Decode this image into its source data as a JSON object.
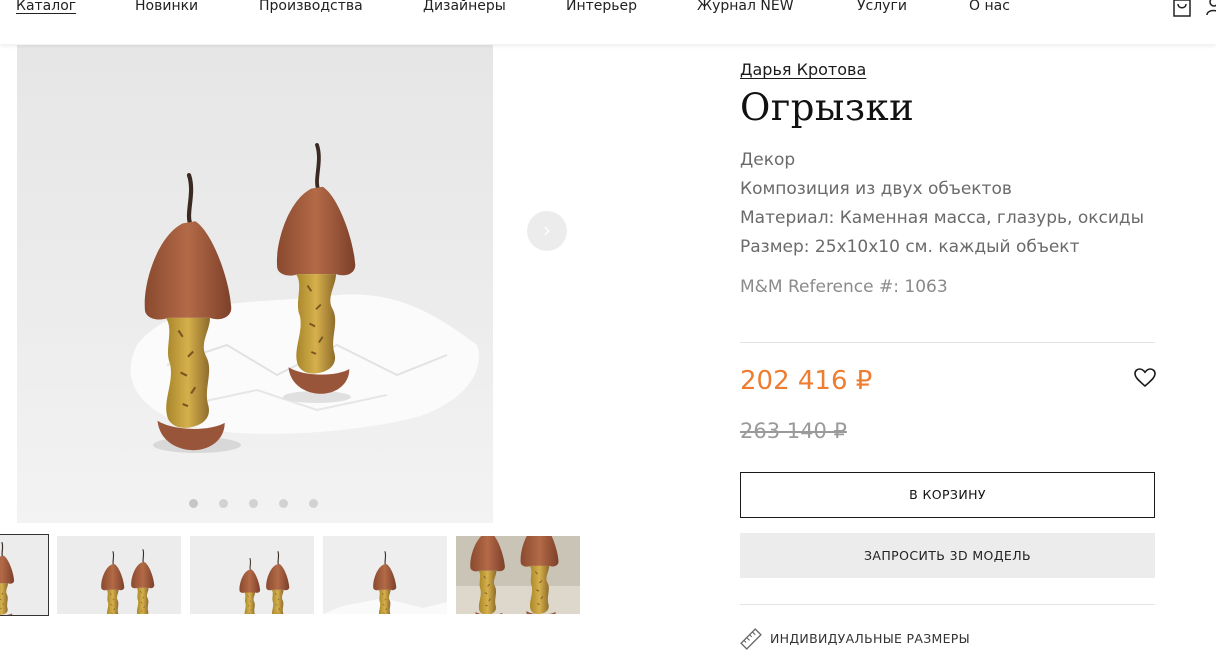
{
  "nav": {
    "items": [
      {
        "label": "Каталог",
        "active": true
      },
      {
        "label": "Новинки"
      },
      {
        "label": "Производства"
      },
      {
        "label": "Дизайнеры"
      },
      {
        "label": "Интерьер"
      },
      {
        "label": "Журнал NEW"
      },
      {
        "label": "Услуги"
      },
      {
        "label": "О нас"
      }
    ],
    "icons": [
      "cart-icon",
      "user-icon"
    ]
  },
  "gallery": {
    "slide_count": 5,
    "active_slide": 1,
    "next_glyph": "›",
    "thumbnails": 5
  },
  "product": {
    "designer": "Дарья Кротова",
    "title": "Огрызки",
    "category": "Декор",
    "composition": "Композиция из двух объектов",
    "material": "Материал: Каменная масса, глазурь, оксиды",
    "size": "Размер: 25х10х10 см. каждый объект",
    "reference": "M&M Reference #: 1063",
    "price": "202 416 ₽",
    "old_price": "263 140 ₽",
    "add_to_cart": "В КОРЗИНУ",
    "request_3d": "ЗАПРОСИТЬ 3D МОДЕЛЬ",
    "custom_sizes": "ИНДИВИДУАЛЬНЫЕ РАЗМЕРЫ"
  },
  "colors": {
    "price": "#ee7d32",
    "accent_button_bg": "#ececec"
  }
}
